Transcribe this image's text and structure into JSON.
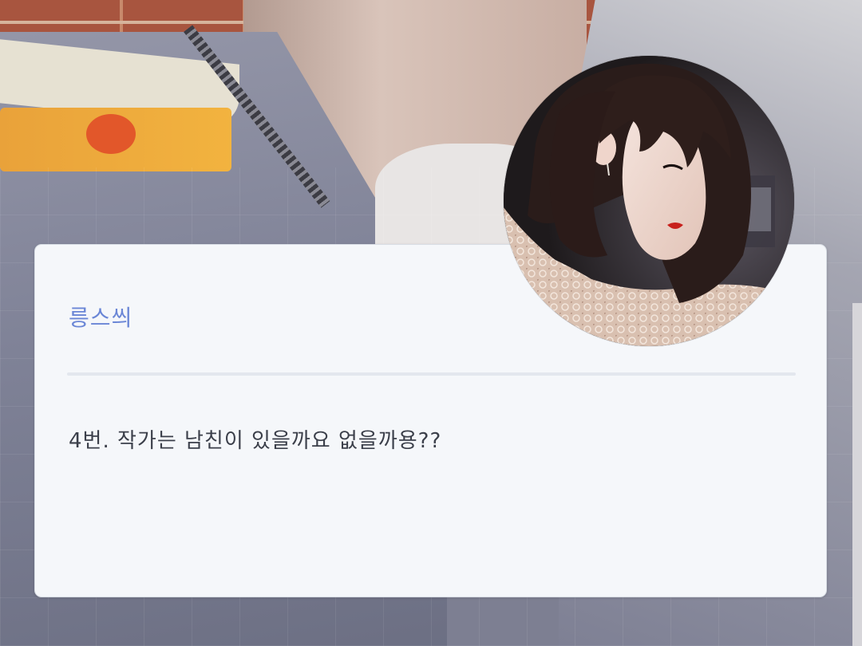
{
  "comment_card": {
    "author_name": "릉스씌",
    "message": "4번. 작가는 남친이 있을까요 없을까용??"
  },
  "avatar": {
    "icon": "profile-photo"
  },
  "colors": {
    "card_background": "#f5f7fa",
    "author_name": "#6a86d6",
    "message_text": "#3b3f4a",
    "divider": "#e3e7ee"
  }
}
